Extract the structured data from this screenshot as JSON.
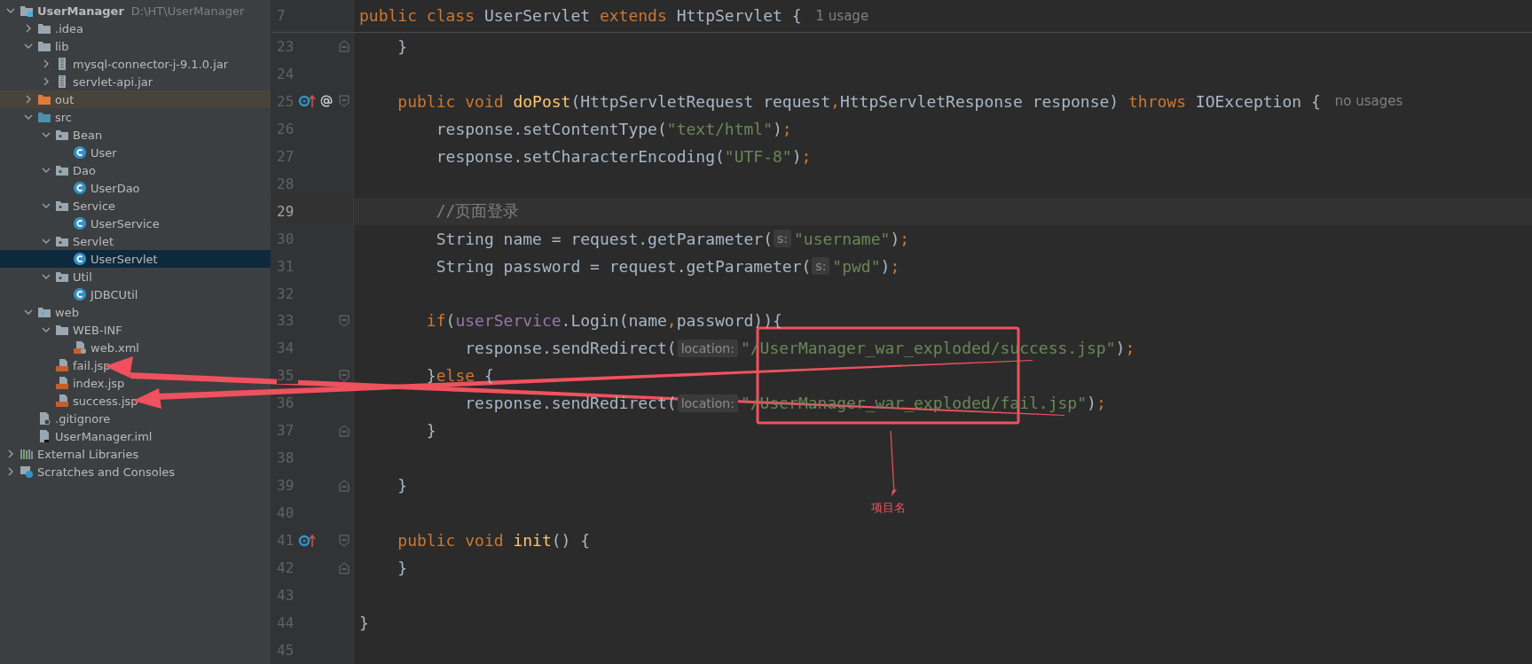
{
  "project_tree": [
    {
      "name": "UserManager",
      "path": "D:\\HT\\UserManager",
      "kind": "module",
      "expanded": true,
      "selected": false,
      "children": [
        {
          "name": ".idea",
          "kind": "folder",
          "expanded": false,
          "selected": false
        },
        {
          "name": "lib",
          "kind": "folder",
          "expanded": true,
          "selected": false,
          "children": [
            {
              "name": "mysql-connector-j-9.1.0.jar",
              "kind": "jar",
              "expanded": false,
              "selected": false
            },
            {
              "name": "servlet-api.jar",
              "kind": "jar",
              "expanded": false,
              "selected": false
            }
          ]
        },
        {
          "name": "out",
          "kind": "excluded",
          "expanded": false,
          "selected": false
        },
        {
          "name": "src",
          "kind": "source",
          "expanded": true,
          "selected": false,
          "children": [
            {
              "name": "Bean",
              "kind": "package",
              "expanded": true,
              "selected": false,
              "children": [
                {
                  "name": "User",
                  "kind": "class",
                  "selected": false
                }
              ]
            },
            {
              "name": "Dao",
              "kind": "package",
              "expanded": true,
              "selected": false,
              "children": [
                {
                  "name": "UserDao",
                  "kind": "class",
                  "selected": false
                }
              ]
            },
            {
              "name": "Service",
              "kind": "package",
              "expanded": true,
              "selected": false,
              "children": [
                {
                  "name": "UserService",
                  "kind": "class",
                  "selected": false
                }
              ]
            },
            {
              "name": "Servlet",
              "kind": "package",
              "expanded": true,
              "selected": false,
              "children": [
                {
                  "name": "UserServlet",
                  "kind": "class",
                  "selected": true
                }
              ]
            },
            {
              "name": "Util",
              "kind": "package",
              "expanded": true,
              "selected": false,
              "children": [
                {
                  "name": "JDBCUtil",
                  "kind": "class",
                  "selected": false
                }
              ]
            }
          ]
        },
        {
          "name": "web",
          "kind": "web",
          "expanded": true,
          "selected": false,
          "children": [
            {
              "name": "WEB-INF",
              "kind": "folder",
              "expanded": true,
              "selected": false,
              "children": [
                {
                  "name": "web.xml",
                  "kind": "xml",
                  "selected": false
                }
              ]
            },
            {
              "name": "fail.jsp",
              "kind": "jsp",
              "selected": false
            },
            {
              "name": "index.jsp",
              "kind": "jsp",
              "selected": false
            },
            {
              "name": "success.jsp",
              "kind": "jsp",
              "selected": false
            }
          ]
        },
        {
          "name": ".gitignore",
          "kind": "gitignore",
          "selected": false
        },
        {
          "name": "UserManager.iml",
          "kind": "iml",
          "selected": false
        }
      ]
    },
    {
      "name": "External Libraries",
      "kind": "libraries",
      "expanded": false,
      "selected": false
    },
    {
      "name": "Scratches and Consoles",
      "kind": "scratches",
      "expanded": false,
      "selected": false
    }
  ],
  "editor": {
    "sticky_line": {
      "number": "7",
      "segments": [
        {
          "kind": "kw",
          "text": "public class "
        },
        {
          "kind": "plain",
          "text": "UserServlet "
        },
        {
          "kind": "kw",
          "text": "extends "
        },
        {
          "kind": "plain",
          "text": "HttpServlet {"
        },
        {
          "kind": "usage",
          "text": "1 usage"
        }
      ]
    },
    "lines": [
      {
        "number": "23",
        "current": false,
        "fold": {
          "kind": "end"
        },
        "segments": [
          {
            "kind": "plain",
            "text": "    }"
          }
        ]
      },
      {
        "number": "24",
        "current": false
      },
      {
        "number": "25",
        "current": false,
        "fold": {
          "kind": "start"
        },
        "gutter": [
          {
            "kind": "override"
          },
          {
            "kind": "annotation"
          }
        ],
        "segments": [
          {
            "kind": "kw",
            "text": "    public void "
          },
          {
            "kind": "decl",
            "text": "doPost"
          },
          {
            "kind": "plain",
            "text": "(HttpServletRequest request"
          },
          {
            "kind": "punct",
            "text": ","
          },
          {
            "kind": "plain",
            "text": "HttpServletResponse response) "
          },
          {
            "kind": "kw",
            "text": "throws "
          },
          {
            "kind": "plain",
            "text": "IOException {"
          },
          {
            "kind": "usage",
            "text": "no usages"
          }
        ]
      },
      {
        "number": "26",
        "current": false,
        "segments": [
          {
            "kind": "plain",
            "text": "        response.setContentType("
          },
          {
            "kind": "str",
            "text": "\"text/html\""
          },
          {
            "kind": "plain",
            "text": ")"
          },
          {
            "kind": "punct",
            "text": ";"
          }
        ]
      },
      {
        "number": "27",
        "current": false,
        "segments": [
          {
            "kind": "plain",
            "text": "        response.setCharacterEncoding("
          },
          {
            "kind": "str",
            "text": "\"UTF-8\""
          },
          {
            "kind": "plain",
            "text": ")"
          },
          {
            "kind": "punct",
            "text": ";"
          }
        ]
      },
      {
        "number": "28",
        "current": false
      },
      {
        "number": "29",
        "current": true,
        "segments": [
          {
            "kind": "comment",
            "text": "        //页面登录"
          }
        ]
      },
      {
        "number": "30",
        "current": false,
        "segments": [
          {
            "kind": "plain",
            "text": "        String name = request.getParameter("
          },
          {
            "kind": "hint",
            "text": "s:"
          },
          {
            "kind": "str",
            "text": "\"username\""
          },
          {
            "kind": "plain",
            "text": ")"
          },
          {
            "kind": "punct",
            "text": ";"
          }
        ]
      },
      {
        "number": "31",
        "current": false,
        "segments": [
          {
            "kind": "plain",
            "text": "        String password = request.getParameter("
          },
          {
            "kind": "hint",
            "text": "s:"
          },
          {
            "kind": "str",
            "text": "\"pwd\""
          },
          {
            "kind": "plain",
            "text": ")"
          },
          {
            "kind": "punct",
            "text": ";"
          }
        ]
      },
      {
        "number": "32",
        "current": false
      },
      {
        "number": "33",
        "current": false,
        "fold": {
          "kind": "start"
        },
        "segments": [
          {
            "kind": "kw",
            "text": "       if"
          },
          {
            "kind": "plain",
            "text": "("
          },
          {
            "kind": "field",
            "text": "userService"
          },
          {
            "kind": "plain",
            "text": ".Login(name"
          },
          {
            "kind": "punct",
            "text": ","
          },
          {
            "kind": "plain",
            "text": "password)){"
          }
        ]
      },
      {
        "number": "34",
        "current": false,
        "segments": [
          {
            "kind": "plain",
            "text": "           response.sendRedirect("
          },
          {
            "kind": "hint",
            "text": "location:"
          },
          {
            "kind": "str",
            "text": "\"/UserManager_war_exploded/success.jsp\""
          },
          {
            "kind": "plain",
            "text": ")"
          },
          {
            "kind": "punct",
            "text": ";"
          }
        ]
      },
      {
        "number": "35",
        "current": false,
        "fold": {
          "kind": "start"
        },
        "segments": [
          {
            "kind": "plain",
            "text": "       }"
          },
          {
            "kind": "kw",
            "text": "else "
          },
          {
            "kind": "plain",
            "text": "{"
          }
        ]
      },
      {
        "number": "36",
        "current": false,
        "segments": [
          {
            "kind": "plain",
            "text": "           response.sendRedirect("
          },
          {
            "kind": "hint",
            "text": "location:"
          },
          {
            "kind": "str",
            "text": "\"/UserManager_war_exploded/fail.jsp\""
          },
          {
            "kind": "plain",
            "text": ")"
          },
          {
            "kind": "punct",
            "text": ";"
          }
        ]
      },
      {
        "number": "37",
        "current": false,
        "fold": {
          "kind": "end"
        },
        "segments": [
          {
            "kind": "plain",
            "text": "       }"
          }
        ]
      },
      {
        "number": "38",
        "current": false
      },
      {
        "number": "39",
        "current": false,
        "fold": {
          "kind": "end"
        },
        "segments": [
          {
            "kind": "plain",
            "text": "    }"
          }
        ]
      },
      {
        "number": "40",
        "current": false
      },
      {
        "number": "41",
        "current": false,
        "fold": {
          "kind": "start"
        },
        "gutter": [
          {
            "kind": "override"
          }
        ],
        "segments": [
          {
            "kind": "kw",
            "text": "    public void "
          },
          {
            "kind": "decl",
            "text": "init"
          },
          {
            "kind": "plain",
            "text": "() {"
          }
        ]
      },
      {
        "number": "42",
        "current": false,
        "fold": {
          "kind": "end"
        },
        "segments": [
          {
            "kind": "plain",
            "text": "    }"
          }
        ]
      },
      {
        "number": "43",
        "current": false
      },
      {
        "number": "44",
        "current": false,
        "segments": [
          {
            "kind": "plain",
            "text": "}"
          }
        ]
      },
      {
        "number": "45",
        "current": false
      }
    ]
  },
  "annotation": {
    "label": "项目名"
  }
}
